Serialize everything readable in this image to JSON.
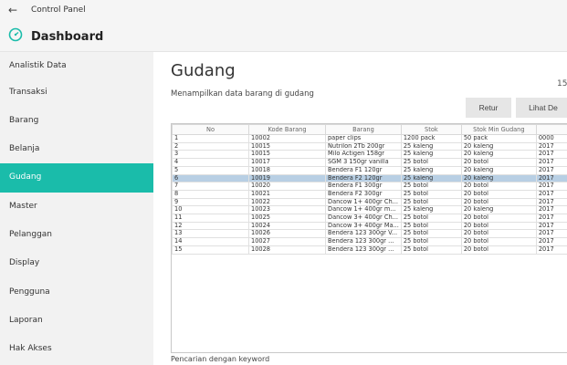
{
  "window": {
    "back_glyph": "←",
    "title": "Control Panel"
  },
  "header": {
    "icon": "speedometer-icon",
    "title": "Dashboard"
  },
  "sidebar": {
    "items": [
      {
        "label": "Analistik Data"
      },
      {
        "label": "Transaksi"
      },
      {
        "label": "Barang"
      },
      {
        "label": "Belanja"
      },
      {
        "label": "Gudang",
        "active": true
      },
      {
        "label": "Master"
      },
      {
        "label": "Pelanggan"
      },
      {
        "label": "Display"
      },
      {
        "label": "Pengguna"
      },
      {
        "label": "Laporan"
      },
      {
        "label": "Hak Akses"
      }
    ],
    "active_color": "#1abcaa"
  },
  "main": {
    "title": "Gudang",
    "page_number": "15",
    "subtitle": "Menampilkan data barang di gudang",
    "buttons": {
      "retur": "Retur",
      "lihat_detail": "Lihat De"
    },
    "search_label": "Pencarian dengan keyword"
  },
  "table": {
    "headers": [
      "No",
      "Kode Barang",
      "Barang",
      "Stok",
      "Stok Min Gudang",
      ""
    ],
    "rows": [
      [
        "1",
        "10002",
        "paper clips",
        "1200 pack",
        "50 pack",
        "0000"
      ],
      [
        "2",
        "10015",
        "Nutrilon 2Tb 200gr",
        "25 kaleng",
        "20 kaleng",
        "2017"
      ],
      [
        "3",
        "10015",
        "Milo Actigen 158gr",
        "25 kaleng",
        "20 kaleng",
        "2017"
      ],
      [
        "4",
        "10017",
        "SGM 3 150gr vanilla",
        "25 botol",
        "20 botol",
        "2017"
      ],
      [
        "5",
        "10018",
        "Bendera F1 120gr",
        "25 kaleng",
        "20 kaleng",
        "2017"
      ],
      [
        "6",
        "10019",
        "Bendera F2 120gr",
        "25 kaleng",
        "20 kaleng",
        "2017"
      ],
      [
        "7",
        "10020",
        "Bendera F1 300gr",
        "25 botol",
        "20 botol",
        "2017"
      ],
      [
        "8",
        "10021",
        "Bendera F2 300gr",
        "25 botol",
        "20 botol",
        "2017"
      ],
      [
        "9",
        "10022",
        "Dancow 1+ 400gr Ch...",
        "25 botol",
        "20 botol",
        "2017"
      ],
      [
        "10",
        "10023",
        "Dancow 1+ 400gr m...",
        "25 kaleng",
        "20 kaleng",
        "2017"
      ],
      [
        "11",
        "10025",
        "Dancow 3+ 400gr Ch...",
        "25 botol",
        "20 botol",
        "2017"
      ],
      [
        "12",
        "10024",
        "Dancow 3+ 400gr Ma...",
        "25 botol",
        "20 botol",
        "2017"
      ],
      [
        "13",
        "10026",
        "Bendera 123 300gr V...",
        "25 botol",
        "20 botol",
        "2017"
      ],
      [
        "14",
        "10027",
        "Bendera 123 300gr ...",
        "25 botol",
        "20 botol",
        "2017"
      ],
      [
        "15",
        "10028",
        "Bendera 123 300gr ...",
        "25 botol",
        "20 botol",
        "2017"
      ]
    ],
    "selected_row": 5,
    "selected_color": "#b8cfe4"
  }
}
